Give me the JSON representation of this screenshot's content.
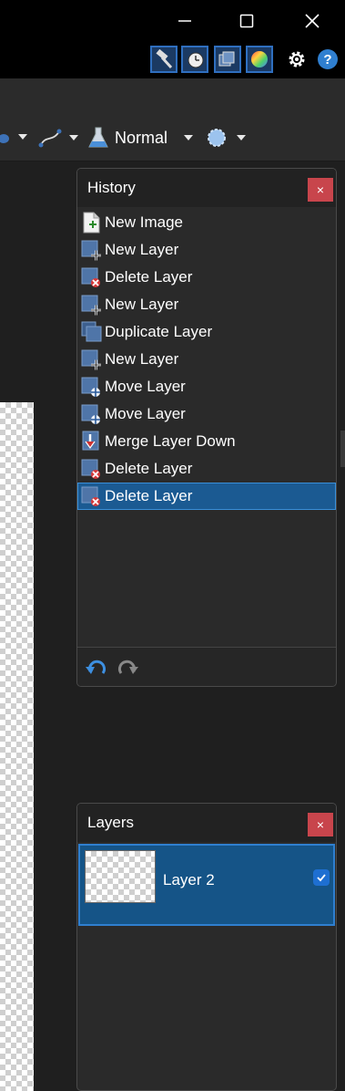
{
  "colors": {
    "accent": "#1b5a92",
    "close": "#c8454c",
    "panel_bg": "#2a2a2a"
  },
  "window": {
    "minimize_icon": "minimize-icon",
    "maximize_icon": "maximize-icon",
    "close_icon": "close-icon"
  },
  "quick_tools": [
    "tools-icon",
    "history-icon",
    "layers-icon",
    "colors-icon"
  ],
  "settings_icon": "gear-icon",
  "help_icon": "help-icon",
  "toolbar": {
    "blend_mode": "Normal"
  },
  "history": {
    "title": "History",
    "close_label": "×",
    "items": [
      {
        "label": "New Image",
        "icon": "new-image-icon"
      },
      {
        "label": "New Layer",
        "icon": "new-layer-icon"
      },
      {
        "label": "Delete Layer",
        "icon": "delete-layer-icon"
      },
      {
        "label": "New Layer",
        "icon": "new-layer-icon"
      },
      {
        "label": "Duplicate Layer",
        "icon": "duplicate-layer-icon"
      },
      {
        "label": "New Layer",
        "icon": "new-layer-icon"
      },
      {
        "label": "Move Layer",
        "icon": "move-layer-icon"
      },
      {
        "label": "Move Layer",
        "icon": "move-layer-icon"
      },
      {
        "label": "Merge Layer Down",
        "icon": "merge-layer-down-icon"
      },
      {
        "label": "Delete Layer",
        "icon": "delete-layer-icon"
      },
      {
        "label": "Delete Layer",
        "icon": "delete-layer-icon",
        "selected": true
      }
    ]
  },
  "layers": {
    "title": "Layers",
    "close_label": "×",
    "items": [
      {
        "name": "Layer 2",
        "visible": true,
        "selected": true
      }
    ]
  }
}
